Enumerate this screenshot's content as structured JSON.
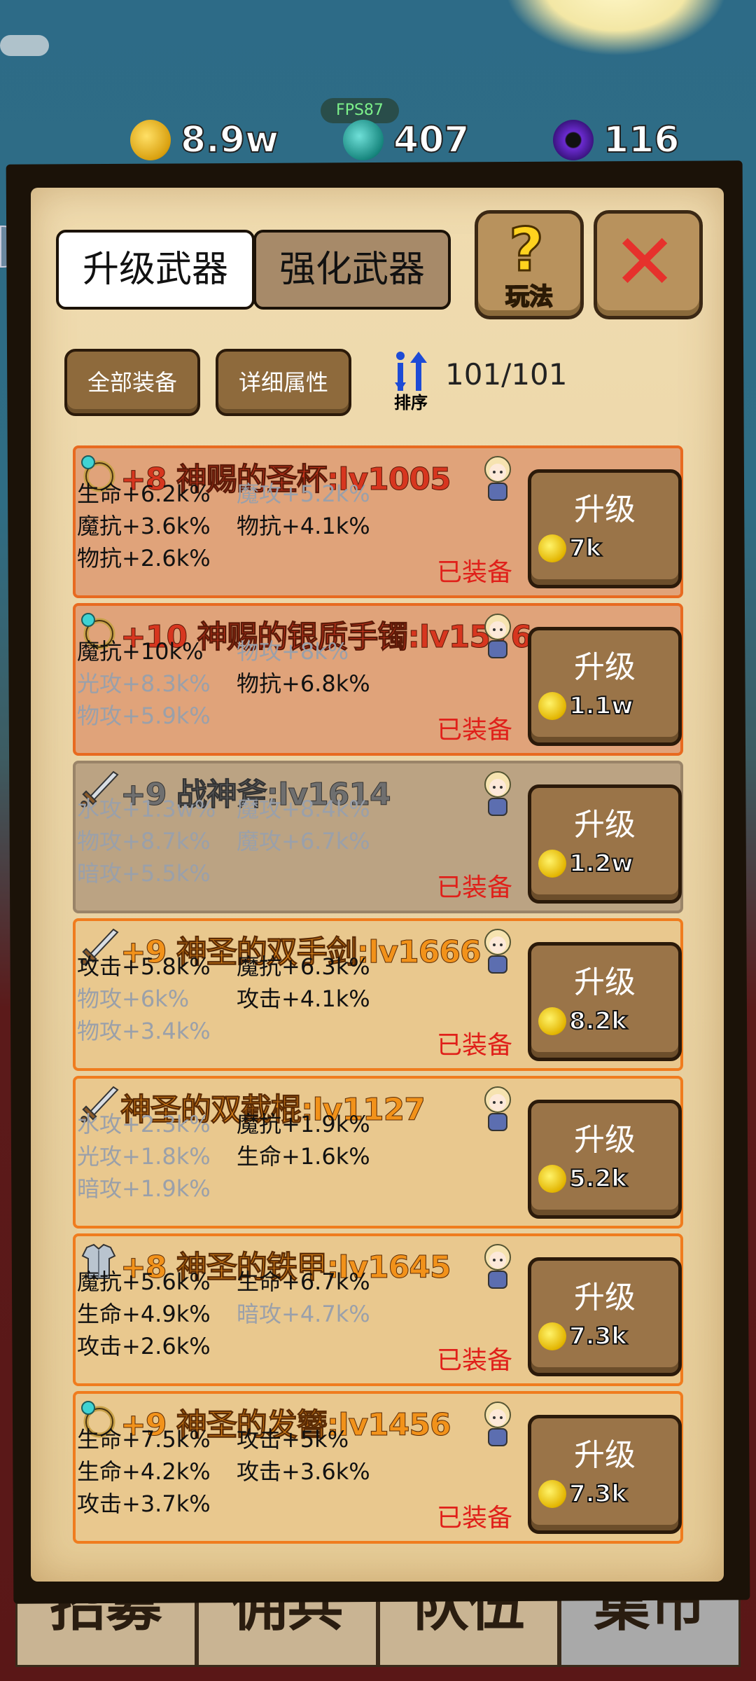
{
  "hud": {
    "fps": "FPS87",
    "gold": "8.9w",
    "gems": "407",
    "orbs": "116"
  },
  "tabs": {
    "upgrade": "升级武器",
    "enhance": "强化武器"
  },
  "help_label": "玩法",
  "buttons": {
    "all_gear": "全部装备",
    "details": "详细属性",
    "sort": "排序"
  },
  "count": "101/101",
  "equipped_label": "已装备",
  "upgrade_label": "升级",
  "bottom_tabs": [
    "招募",
    "佣兵",
    "队伍",
    "集市"
  ],
  "items": [
    {
      "name": "+8 神赐的圣杯:lv1005",
      "icon": "ring-icon",
      "style": "red",
      "stats": [
        [
          "生命+6.2k%",
          false
        ],
        [
          "魔攻+5.2k%",
          true
        ],
        [
          "魔抗+3.6k%",
          false
        ],
        [
          "物抗+4.1k%",
          false
        ],
        [
          "物抗+2.6k%",
          false
        ]
      ],
      "equipped": true,
      "cost": "7k"
    },
    {
      "name": "+10 神赐的银质手镯:lv1576",
      "icon": "ring-icon",
      "style": "red",
      "stats": [
        [
          "魔抗+10k%",
          false
        ],
        [
          "物攻+8k%",
          true
        ],
        [
          "光攻+8.3k%",
          true
        ],
        [
          "物抗+6.8k%",
          false
        ],
        [
          "物攻+5.9k%",
          true
        ]
      ],
      "equipped": true,
      "cost": "1.1w"
    },
    {
      "name": "+9 战神斧:lv1614",
      "icon": "sword-icon",
      "style": "grey",
      "stats": [
        [
          "水攻+1.3w%",
          true
        ],
        [
          "魔攻+8.4k%",
          true
        ],
        [
          "物攻+8.7k%",
          true
        ],
        [
          "魔攻+6.7k%",
          true
        ],
        [
          "暗攻+5.5k%",
          true
        ]
      ],
      "equipped": true,
      "cost": "1.2w"
    },
    {
      "name": "+9 神圣的双手剑:lv1666",
      "icon": "sword-icon",
      "style": "orange",
      "stats": [
        [
          "攻击+5.8k%",
          false
        ],
        [
          "魔抗+6.3k%",
          false
        ],
        [
          "物攻+6k%",
          true
        ],
        [
          "攻击+4.1k%",
          false
        ],
        [
          "物攻+3.4k%",
          true
        ]
      ],
      "equipped": true,
      "cost": "8.2k"
    },
    {
      "name": "神圣的双截棍:lv1127",
      "icon": "sword-icon",
      "style": "orange",
      "stats": [
        [
          "水攻+2.3k%",
          true
        ],
        [
          "魔抗+1.9k%",
          false
        ],
        [
          "光攻+1.8k%",
          true
        ],
        [
          "生命+1.6k%",
          false
        ],
        [
          "暗攻+1.9k%",
          true
        ]
      ],
      "equipped": false,
      "cost": "5.2k"
    },
    {
      "name": "+8 神圣的铁甲:lv1645",
      "icon": "armor-icon",
      "style": "orange",
      "stats": [
        [
          "魔抗+5.6k%",
          false
        ],
        [
          "生命+6.7k%",
          false
        ],
        [
          "生命+4.9k%",
          false
        ],
        [
          "暗攻+4.7k%",
          true
        ],
        [
          "攻击+2.6k%",
          false
        ]
      ],
      "equipped": true,
      "cost": "7.3k"
    },
    {
      "name": "+9 神圣的发簪:lv1456",
      "icon": "ring-icon",
      "style": "orange",
      "stats": [
        [
          "生命+7.5k%",
          false
        ],
        [
          "攻击+5k%",
          false
        ],
        [
          "生命+4.2k%",
          false
        ],
        [
          "攻击+3.6k%",
          false
        ],
        [
          "攻击+3.7k%",
          false
        ]
      ],
      "equipped": true,
      "cost": "7.3k"
    }
  ]
}
